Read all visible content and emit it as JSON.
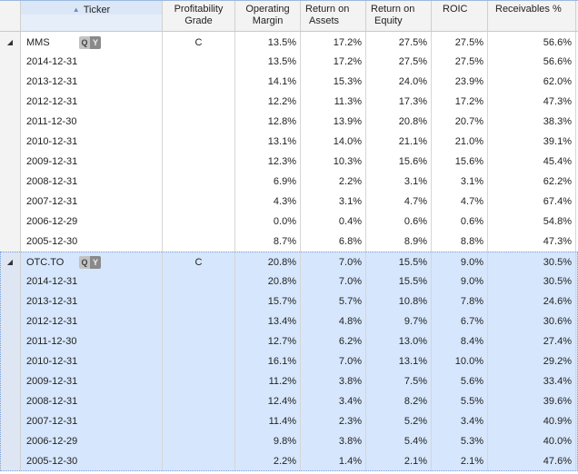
{
  "columns": {
    "ticker": "Ticker",
    "pg_line1": "Profitability",
    "pg_line2": "Grade",
    "om_line1": "Operating",
    "om_line2": "Margin",
    "roa_line1": "Return on",
    "roa_line2": "Assets",
    "roe_line1": "Return on",
    "roe_line2": "Equity",
    "roic": "ROIC",
    "rec": "Receivables %",
    "sort_indicator": "▲"
  },
  "qy_toggle": {
    "q": "Q",
    "y": "Y"
  },
  "expand_glyph": "◢",
  "groups": [
    {
      "ticker": "MMS",
      "grade": "C",
      "selected": false,
      "summary": {
        "om": "13.5%",
        "roa": "17.2%",
        "roe": "27.5%",
        "roic": "27.5%",
        "rec": "56.6%"
      },
      "rows": [
        {
          "date": "2014-12-31",
          "om": "13.5%",
          "roa": "17.2%",
          "roe": "27.5%",
          "roic": "27.5%",
          "rec": "56.6%"
        },
        {
          "date": "2013-12-31",
          "om": "14.1%",
          "roa": "15.3%",
          "roe": "24.0%",
          "roic": "23.9%",
          "rec": "62.0%"
        },
        {
          "date": "2012-12-31",
          "om": "12.2%",
          "roa": "11.3%",
          "roe": "17.3%",
          "roic": "17.2%",
          "rec": "47.3%"
        },
        {
          "date": "2011-12-30",
          "om": "12.8%",
          "roa": "13.9%",
          "roe": "20.8%",
          "roic": "20.7%",
          "rec": "38.3%"
        },
        {
          "date": "2010-12-31",
          "om": "13.1%",
          "roa": "14.0%",
          "roe": "21.1%",
          "roic": "21.0%",
          "rec": "39.1%"
        },
        {
          "date": "2009-12-31",
          "om": "12.3%",
          "roa": "10.3%",
          "roe": "15.6%",
          "roic": "15.6%",
          "rec": "45.4%"
        },
        {
          "date": "2008-12-31",
          "om": "6.9%",
          "roa": "2.2%",
          "roe": "3.1%",
          "roic": "3.1%",
          "rec": "62.2%"
        },
        {
          "date": "2007-12-31",
          "om": "4.3%",
          "roa": "3.1%",
          "roe": "4.7%",
          "roic": "4.7%",
          "rec": "67.4%"
        },
        {
          "date": "2006-12-29",
          "om": "0.0%",
          "roa": "0.4%",
          "roe": "0.6%",
          "roic": "0.6%",
          "rec": "54.8%"
        },
        {
          "date": "2005-12-30",
          "om": "8.7%",
          "roa": "6.8%",
          "roe": "8.9%",
          "roic": "8.8%",
          "rec": "47.3%"
        }
      ]
    },
    {
      "ticker": "OTC.TO",
      "grade": "C",
      "selected": true,
      "summary": {
        "om": "20.8%",
        "roa": "7.0%",
        "roe": "15.5%",
        "roic": "9.0%",
        "rec": "30.5%"
      },
      "rows": [
        {
          "date": "2014-12-31",
          "om": "20.8%",
          "roa": "7.0%",
          "roe": "15.5%",
          "roic": "9.0%",
          "rec": "30.5%"
        },
        {
          "date": "2013-12-31",
          "om": "15.7%",
          "roa": "5.7%",
          "roe": "10.8%",
          "roic": "7.8%",
          "rec": "24.6%"
        },
        {
          "date": "2012-12-31",
          "om": "13.4%",
          "roa": "4.8%",
          "roe": "9.7%",
          "roic": "6.7%",
          "rec": "30.6%"
        },
        {
          "date": "2011-12-30",
          "om": "12.7%",
          "roa": "6.2%",
          "roe": "13.0%",
          "roic": "8.4%",
          "rec": "27.4%"
        },
        {
          "date": "2010-12-31",
          "om": "16.1%",
          "roa": "7.0%",
          "roe": "13.1%",
          "roic": "10.0%",
          "rec": "29.2%"
        },
        {
          "date": "2009-12-31",
          "om": "11.2%",
          "roa": "3.8%",
          "roe": "7.5%",
          "roic": "5.6%",
          "rec": "33.4%"
        },
        {
          "date": "2008-12-31",
          "om": "12.4%",
          "roa": "3.4%",
          "roe": "8.2%",
          "roic": "5.5%",
          "rec": "39.6%"
        },
        {
          "date": "2007-12-31",
          "om": "11.4%",
          "roa": "2.3%",
          "roe": "5.2%",
          "roic": "3.4%",
          "rec": "40.9%"
        },
        {
          "date": "2006-12-29",
          "om": "9.8%",
          "roa": "3.8%",
          "roe": "5.4%",
          "roic": "5.3%",
          "rec": "40.0%"
        },
        {
          "date": "2005-12-30",
          "om": "2.2%",
          "roa": "1.4%",
          "roe": "2.1%",
          "roic": "2.1%",
          "rec": "47.6%"
        }
      ]
    }
  ]
}
